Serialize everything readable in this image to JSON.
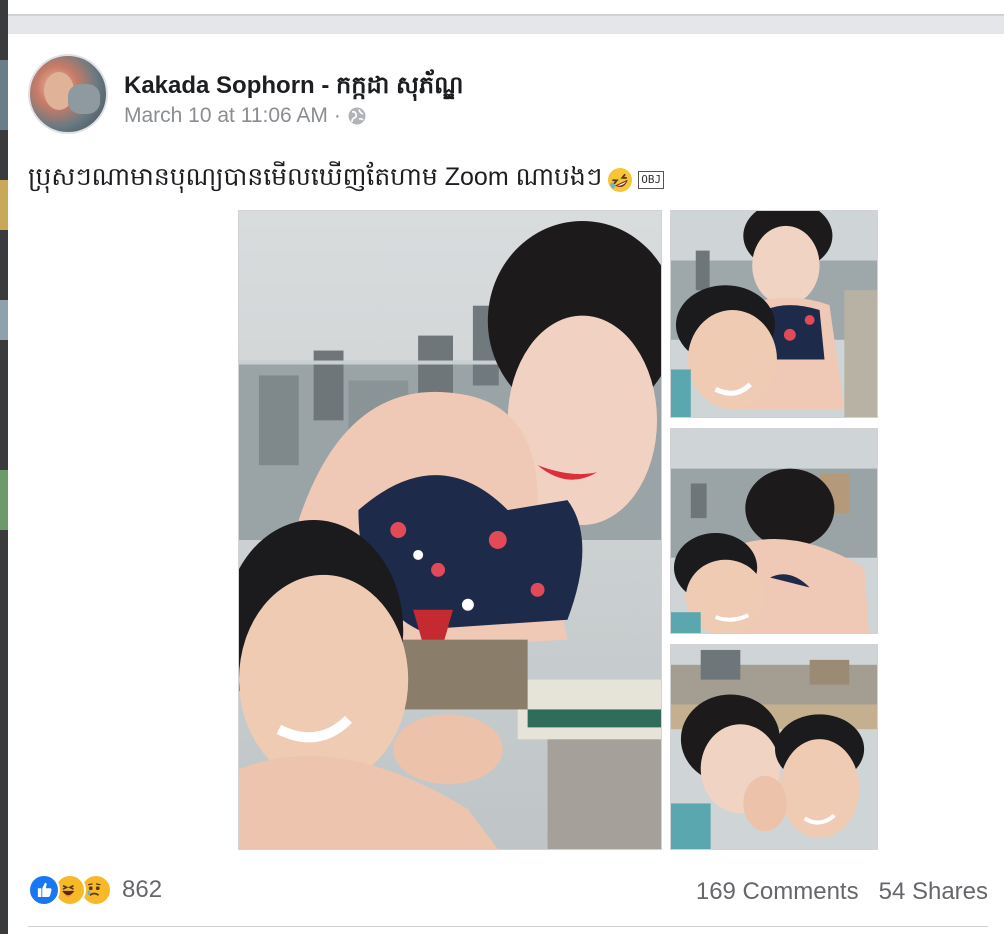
{
  "post": {
    "author": "Kakada Sophorn - កក្កដា សុភ័ណ្ឌ",
    "timestamp": "March 10 at 11:06 AM",
    "separator": "·",
    "privacy_icon": "globe-icon",
    "text": "ប្រុសៗណាមានបុណ្យបានមើលឃើញតែហាម Zoom ណាបងៗ",
    "emoji": "rolling-on-floor-laughing",
    "obj_marker": "OBJ"
  },
  "photos": [
    {
      "name": "main-photo"
    },
    {
      "name": "thumbnail-1"
    },
    {
      "name": "thumbnail-2"
    },
    {
      "name": "thumbnail-3"
    }
  ],
  "reactions": {
    "icons": [
      "like-icon",
      "haha-icon",
      "sad-icon"
    ],
    "count": "862"
  },
  "stats": {
    "comments": "169 Comments",
    "shares": "54 Shares"
  },
  "colors": {
    "text_primary": "#1c1e21",
    "text_secondary": "#65676b",
    "like_blue": "#1877f2",
    "reaction_yellow": "#f7b928"
  }
}
